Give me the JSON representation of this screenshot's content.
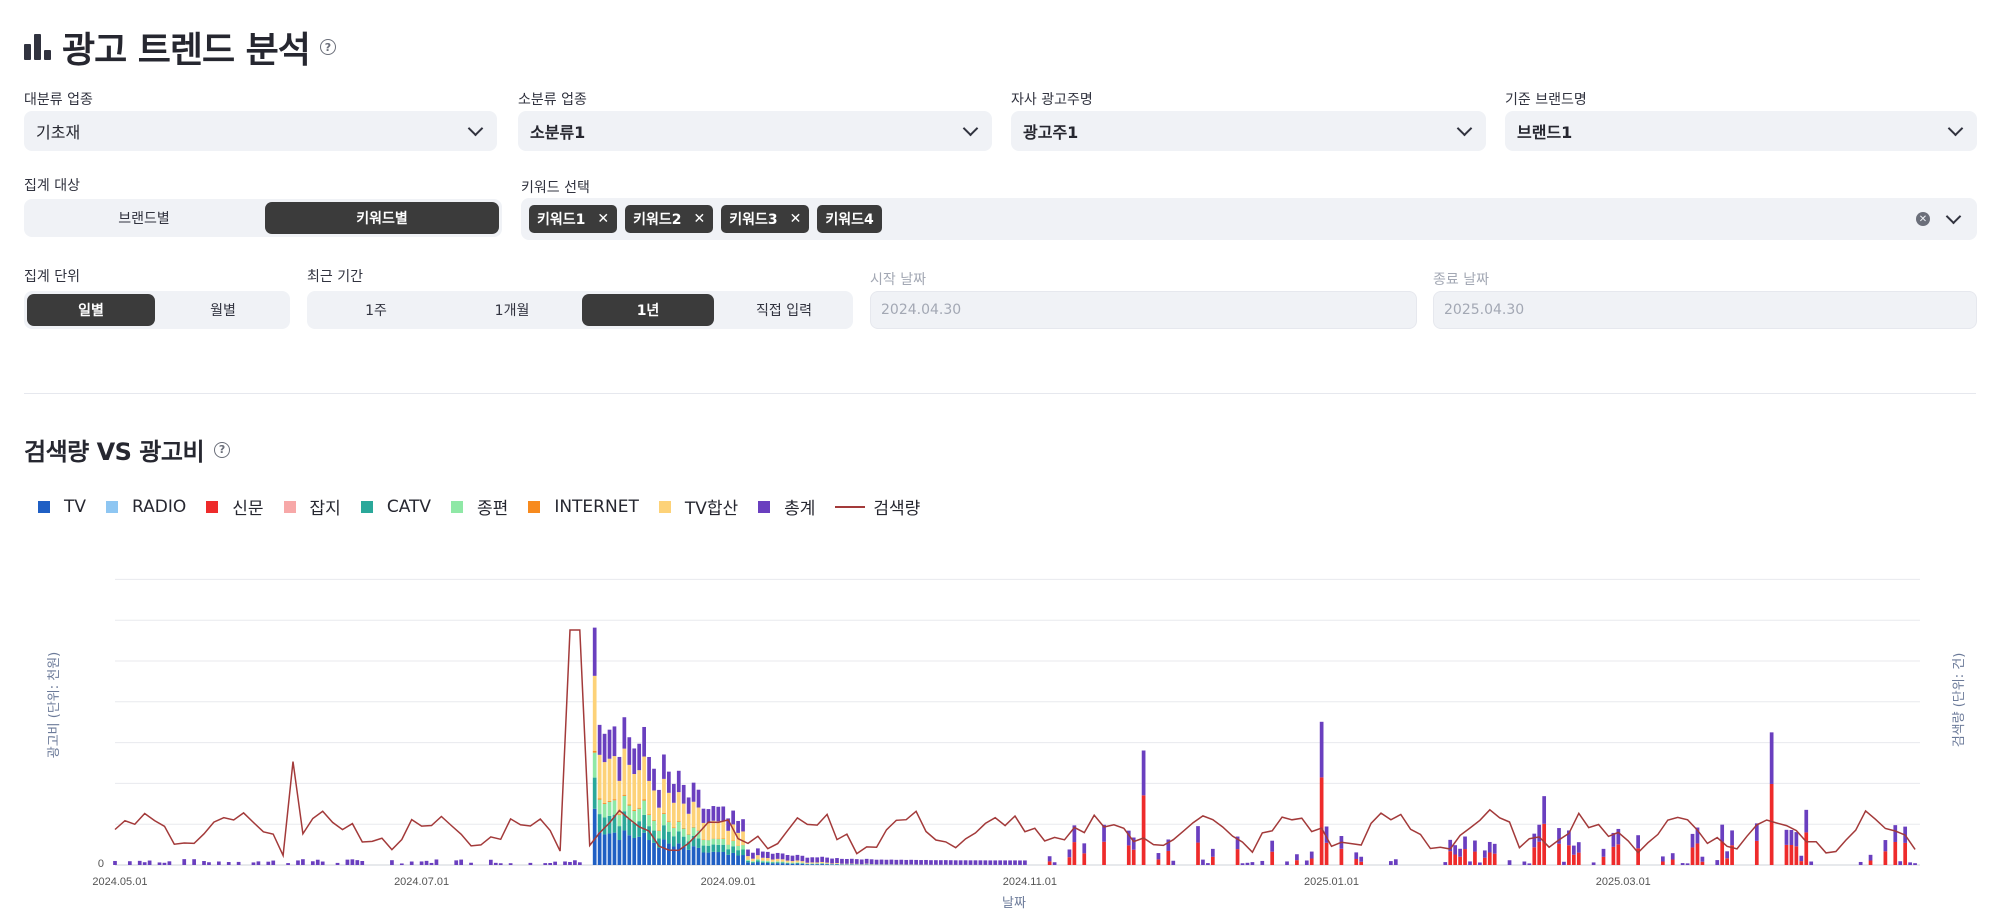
{
  "header": {
    "title": "광고 트렌드 분석",
    "help_icon": "question-circle-icon",
    "title_icon": "bar-chart-icon"
  },
  "filters": {
    "major_category": {
      "label": "대분류 업종",
      "value": "기초재"
    },
    "minor_category": {
      "label": "소분류 업종",
      "value": "소분류1"
    },
    "advertiser": {
      "label": "자사 광고주명",
      "value": "광고주1"
    },
    "brand": {
      "label": "기준 브랜드명",
      "value": "브랜드1"
    }
  },
  "aggregation_target": {
    "label": "집계 대상",
    "options": [
      "브랜드별",
      "키워드별"
    ],
    "selected": "키워드별"
  },
  "keyword_select": {
    "label": "키워드 선택",
    "chips": [
      "키워드1",
      "키워드2",
      "키워드3",
      "키워드4"
    ]
  },
  "aggregation_unit": {
    "label": "집계 단위",
    "options": [
      "일별",
      "월별"
    ],
    "selected": "일별"
  },
  "recent_period": {
    "label": "최근 기간",
    "options": [
      "1주",
      "1개월",
      "1년",
      "직접 입력"
    ],
    "selected": "1년"
  },
  "start_date": {
    "label": "시작 날짜",
    "value": "2024.04.30"
  },
  "end_date": {
    "label": "종료 날짜",
    "value": "2025.04.30"
  },
  "section": {
    "title": "검색량 VS 광고비"
  },
  "colors": {
    "TV": "#1f5fc4",
    "RADIO": "#8ec6f2",
    "신문": "#ee2b2b",
    "잡지": "#f7a8a8",
    "CATV": "#2aa89a",
    "종편": "#8fe8a6",
    "INTERNET": "#f78a1e",
    "TV합산": "#fdd278",
    "총계": "#6a3fbf",
    "검색량": "#a33a3a"
  },
  "chart_data": {
    "type": "bar",
    "title": "",
    "xlabel": "날짜",
    "ylabel": "광고비 (단위: 천원)",
    "y2label": "검색량 (단위: 건)",
    "y_zero_label": "0",
    "x_tick_labels": [
      "2024.05.01",
      "2024.07.01",
      "2024.09.01",
      "2024.11.01",
      "2025.01.01",
      "2025.03.01"
    ],
    "x_range": [
      "2024.04.30",
      "2025.04.30"
    ],
    "legend": [
      "TV",
      "RADIO",
      "신문",
      "잡지",
      "CATV",
      "종편",
      "INTERNET",
      "TV합산",
      "총계",
      "검색량"
    ],
    "legend_position": "top-left",
    "grid": true,
    "series_note": "stacked bars by media type with 총계 on top; 검색량 as line on secondary axis",
    "bar_series": [
      {
        "name": "TV",
        "values": {
          "2024-08-05": 18,
          "2024-08-10": 22,
          "2024-08-15": 16,
          "2024-08-20": 12,
          "2024-08-25": 8,
          "2024-08-30": 5
        }
      },
      {
        "name": "CATV",
        "values": {
          "2024-08-05": 12,
          "2024-08-10": 14,
          "2024-08-15": 10,
          "2024-08-20": 8,
          "2024-08-25": 6,
          "2024-08-30": 4
        }
      },
      {
        "name": "종편",
        "values": {
          "2024-08-05": 8,
          "2024-08-10": 9,
          "2024-08-15": 7,
          "2024-08-20": 5,
          "2024-08-25": 3,
          "2024-08-30": 2
        }
      },
      {
        "name": "TV합산",
        "values": {
          "2024-08-05": 35,
          "2024-08-10": 38,
          "2024-08-15": 28,
          "2024-08-20": 18,
          "2024-08-25": 10,
          "2024-08-30": 6
        }
      },
      {
        "name": "신문",
        "values": {
          "2024-11-01": 12,
          "2024-12-01": 18,
          "2025-01-01": 25,
          "2025-02-01": 15,
          "2025-03-01": 20,
          "2025-03-15": 30
        }
      },
      {
        "name": "총계",
        "values": {
          "2024-08-05": 95,
          "2024-08-10": 100,
          "2024-08-15": 78,
          "2024-08-20": 52,
          "2024-08-25": 36,
          "2024-11-01": 30,
          "2024-12-01": 40,
          "2025-01-01": 42,
          "2025-03-15": 58
        }
      }
    ],
    "line_series": {
      "name": "검색량",
      "peaks": {
        "2024-06-05": 44,
        "2024-08-01": 100
      }
    }
  }
}
